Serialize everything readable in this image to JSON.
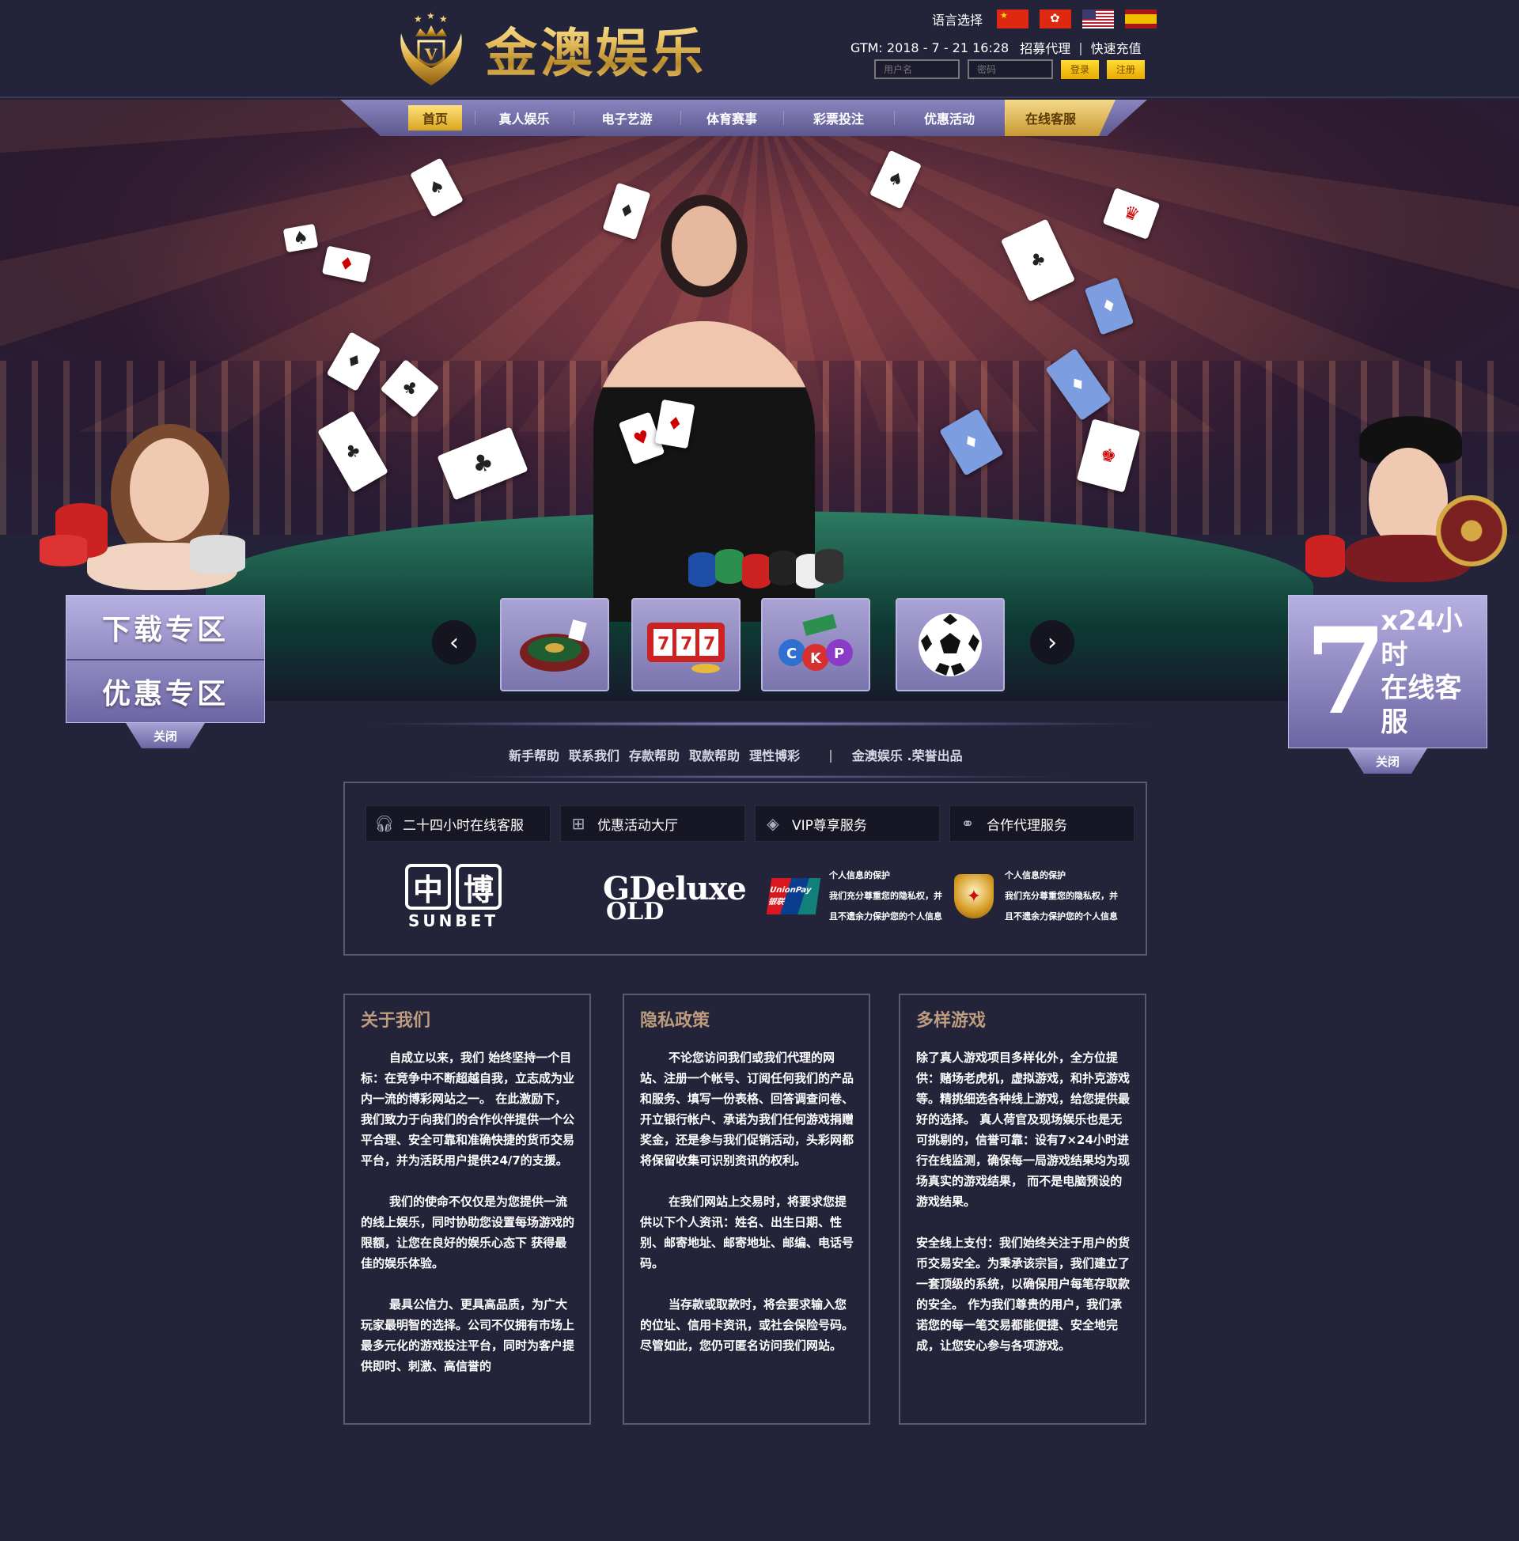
{
  "brand": {
    "name": "金澳娱乐"
  },
  "header": {
    "lang_label": "语言选择",
    "flags": [
      "cn",
      "hk",
      "us",
      "es"
    ],
    "gtm": "GTM: 2018 - 7 - 21  16:28",
    "recruit_agent": "招募代理",
    "quick_recharge": "快速充值",
    "username_placeholder": "用户名",
    "password_placeholder": "密码",
    "login_label": "登录",
    "register_label": "注册"
  },
  "nav": {
    "items": [
      "首页",
      "真人娱乐",
      "电子艺游",
      "体育赛事",
      "彩票投注",
      "优惠活动",
      "在线客服"
    ],
    "active_index": 0
  },
  "left_panel": {
    "download": "下载专区",
    "promo": "优惠专区",
    "close": "关闭"
  },
  "right_panel": {
    "big_number": "7",
    "line1": "x24小时",
    "line2": "在线客服",
    "close": "关闭"
  },
  "carousel": {
    "prev_icon": "chevron-left-icon",
    "next_icon": "chevron-right-icon",
    "items": [
      "roulette",
      "slot-machine",
      "bingo-balls",
      "soccer-ball"
    ]
  },
  "footer_links": {
    "links": [
      "新手帮助",
      "联系我们",
      "存款帮助",
      "取款帮助",
      "理性博彩"
    ],
    "brand_credit": "金澳娱乐 .荣誉出品"
  },
  "services": {
    "tabs": [
      {
        "label": "二十四小时在线客服",
        "icon": "headset-icon"
      },
      {
        "label": "优惠活动大厅",
        "icon": "gift-icon"
      },
      {
        "label": "VIP尊享服务",
        "icon": "diamond-icon"
      },
      {
        "label": "合作代理服务",
        "icon": "handshake-icon"
      }
    ],
    "sunbet": {
      "chars": [
        "中",
        "博"
      ],
      "word": "SUNBET"
    },
    "gold": {
      "line1": "Deluxe",
      "prefix": "G",
      "line2": "OLD"
    },
    "unionpay": {
      "logo": "UnionPay 银联"
    },
    "protection_1": {
      "title": "个人信息的保护",
      "line2": "我们充分尊重您的隐私权，并",
      "line3": "且不遗余力保护您的个人信息"
    },
    "protection_2": {
      "title": "个人信息的保护",
      "line2": "我们充分尊重您的隐私权，并",
      "line3": "且不遗余力保护您的个人信息"
    }
  },
  "columns": [
    {
      "title": "关于我们",
      "paragraphs": [
        "自成立以来，我们 始终坚持一个目标：在竞争中不断超越自我，立志成为业内一流的博彩网站之一。 在此激励下， 我们致力于向我们的合作伙伴提供一个公平合理、安全可靠和准确快捷的货币交易平台，并为活跃用户提供24/7的支援。",
        "我们的使命不仅仅是为您提供一流的线上娱乐，同时协助您设置每场游戏的限额，让您在良好的娱乐心态下 获得最佳的娱乐体验。",
        "最具公信力、更具高品质，为广大玩家最明智的选择。公司不仅拥有市场上 最多元化的游戏投注平台，同时为客户提供即时、刺激、高信誉的"
      ]
    },
    {
      "title": "隐私政策",
      "paragraphs": [
        "不论您访问我们或我们代理的网站、注册一个帐号、订阅任何我们的产品和服务、填写一份表格、回答调查问卷、开立银行帐户、承诺为我们任何游戏捐赠奖金，还是参与我们促销活动，头彩网都将保留收集可识别资讯的权利。",
        "在我们网站上交易时，将要求您提供以下个人资讯：姓名、出生日期、性别、邮寄地址、邮寄地址、邮编、电话号码。",
        "当存款或取款时，将会要求输入您的位址、信用卡资讯，或社会保险号码。尽管如此，您仍可匿名访问我们网站。"
      ]
    },
    {
      "title": "多样游戏",
      "paragraphs": [
        "除了真人游戏项目多样化外，全方位提供：赌场老虎机，虚拟游戏，和扑克游戏等。精挑细选各种线上游戏，给您提供最好的选择。 真人荷官及现场娱乐也是无可挑剔的，信誉可靠：设有7×24小时进行在线监测，确保每一局游戏结果均为现场真实的游戏结果， 而不是电脑预设的游戏结果。",
        "安全线上支付：我们始终关注于用户的货币交易安全。为秉承该宗旨，我们建立了一套顶级的系统，以确保用户每笔存取款的安全。 作为我们尊贵的用户，我们承诺您的每一笔交易都能便捷、安全地完成，让您安心参与各项游戏。"
      ]
    }
  ]
}
